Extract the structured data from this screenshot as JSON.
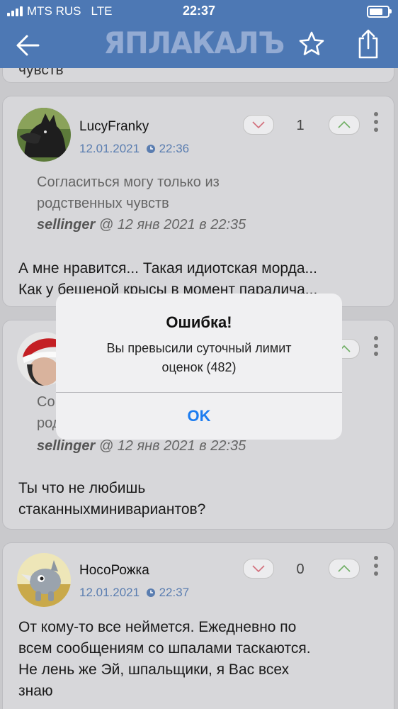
{
  "status_bar": {
    "carrier": "MTS RUS",
    "network": "LTE",
    "time": "22:37"
  },
  "nav": {
    "logo": "ЯПЛАКАЛЪ",
    "icons": [
      "back-arrow-icon",
      "star-icon",
      "share-icon"
    ]
  },
  "feed": {
    "top_fragment": "чувств",
    "posts": [
      {
        "author": "LucyFranky",
        "date": "12.01.2021",
        "time": "22:36",
        "score": "1",
        "quote_lines": [
          "Согласиться могу только из",
          "родственных чувств"
        ],
        "quote_author": "sellinger",
        "quote_meta": "@ 12 янв 2021 в 22:35",
        "text_lines": [
          "А мне нравится... Такая идиотская морда...",
          "Как у бешеной крысы в момент паралича..."
        ]
      },
      {
        "author": "",
        "date": "",
        "time": "",
        "score": "",
        "quote_lines": [
          "Со",
          "род"
        ],
        "quote_author": "sellinger",
        "quote_meta": "@ 12 янв 2021 в 22:35",
        "text_lines": [
          "Ты что не любишь",
          "стаканныхминивариантов?"
        ]
      },
      {
        "author": "НосоРожка",
        "date": "12.01.2021",
        "time": "22:37",
        "score": "0",
        "text_lines": [
          "От кому-то все неймется. Ежедневно по",
          "всем сообщениям со шпалами таскаются.",
          "Не лень же  Эй, шпальщики, я Вас всех",
          "знаю"
        ]
      }
    ]
  },
  "dialog": {
    "title": "Ошибка!",
    "message_lines": [
      "Вы превысили суточный лимит",
      "оценок (482)"
    ],
    "ok_label": "OK"
  },
  "colors": {
    "header_bg": "#4d78b4",
    "link_blue": "#5a7db0",
    "dialog_button": "#1c7cf0"
  }
}
